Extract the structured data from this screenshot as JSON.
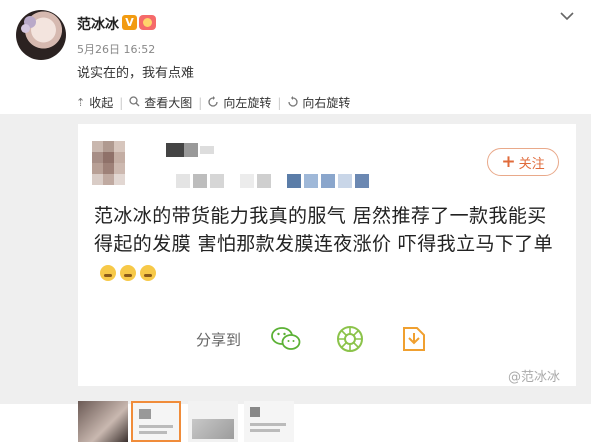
{
  "post": {
    "username": "范冰冰",
    "verified_badge": "V",
    "timestamp": "5月26日 16:52",
    "text": "说实在的，我有点难"
  },
  "image_actions": {
    "collapse": "收起",
    "view_large": "查看大图",
    "rotate_left": "向左旋转",
    "rotate_right": "向右旋转"
  },
  "screenshot_card": {
    "follow_label": "关注",
    "text": "范冰冰的带货能力我真的服气  居然推荐了一款我能买得起的发膜  害怕那款发膜连夜涨价  吓得我立马下了单",
    "share_label": "分享到"
  },
  "watermark": "@范冰冰",
  "colors": {
    "accent_orange": "#e06b3b",
    "wechat_green": "#5bb135",
    "moments_green": "#8bc34a",
    "save_orange": "#f0a030"
  }
}
